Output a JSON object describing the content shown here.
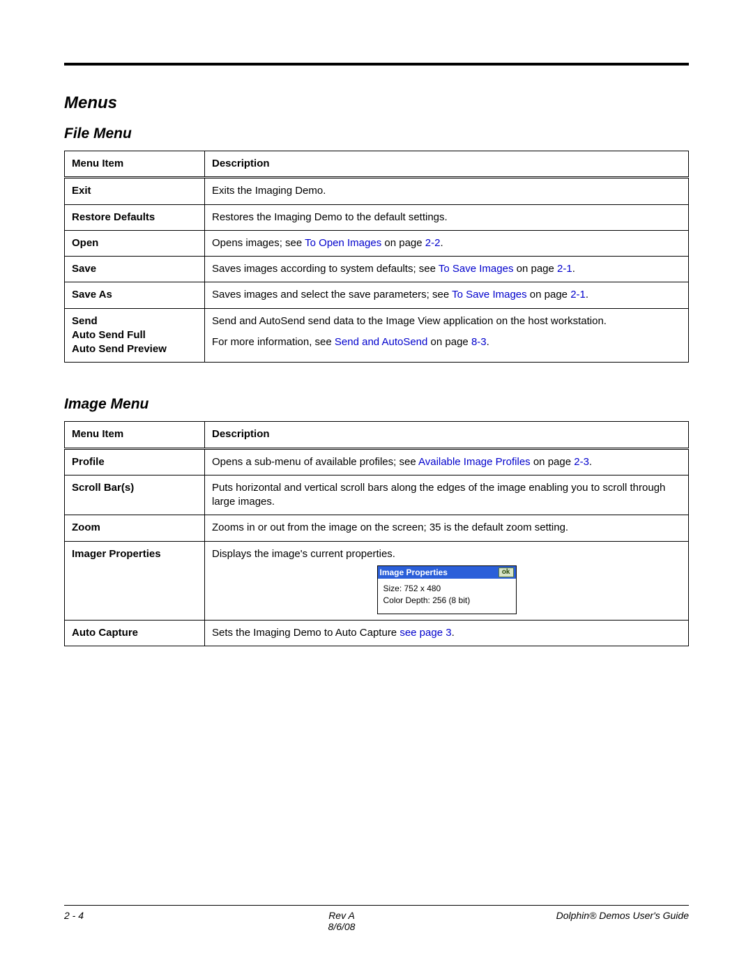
{
  "section_title": "Menus",
  "file_menu": {
    "title": "File Menu",
    "headers": {
      "item": "Menu Item",
      "desc": "Description"
    },
    "rows": {
      "exit": {
        "item": "Exit",
        "desc": "Exits the Imaging Demo."
      },
      "restore": {
        "item": "Restore Defaults",
        "desc": "Restores the Imaging Demo to the default settings."
      },
      "open": {
        "item": "Open",
        "pre": "Opens images; see ",
        "link": "To Open Images",
        "post": " on page ",
        "page": "2-2",
        "tail": "."
      },
      "save": {
        "item": "Save",
        "pre": "Saves images according to system defaults; see ",
        "link": "To Save Images",
        "post": " on page ",
        "page": "2-1",
        "tail": "."
      },
      "saveas": {
        "item": "Save As",
        "pre": "Saves images and select the save parameters; see ",
        "link": "To Save Images",
        "post": " on page ",
        "page": "2-1",
        "tail": "."
      },
      "send": {
        "item1": "Send",
        "item2": "Auto Send Full",
        "item3": "Auto Send Preview",
        "line1": "Send and AutoSend send data to the Image View application on the host workstation.",
        "pre": "For more information, see ",
        "link": "Send and AutoSend",
        "post": " on page ",
        "page": "8-3",
        "tail": "."
      }
    }
  },
  "image_menu": {
    "title": "Image Menu",
    "headers": {
      "item": "Menu Item",
      "desc": "Description"
    },
    "rows": {
      "profile": {
        "item": "Profile",
        "pre": "Opens a sub-menu of available profiles; see ",
        "link": "Available Image Profiles",
        "post": " on page ",
        "page": "2-3",
        "tail": "."
      },
      "scroll": {
        "item": "Scroll Bar(s)",
        "desc": "Puts horizontal and vertical scroll bars along the edges of the image enabling you to scroll through large images."
      },
      "zoom": {
        "item": "Zoom",
        "desc": "Zooms in or out from the image on the screen; 35 is the default zoom setting."
      },
      "imager": {
        "item": "Imager Properties",
        "desc": "Displays the image's current properties.",
        "dlg_title": "Image Properties",
        "dlg_ok": "ok",
        "dlg_size": "Size: 752 x 480",
        "dlg_depth": "Color Depth: 256 (8 bit)"
      },
      "auto": {
        "item": "Auto Capture",
        "pre": "Sets the Imaging Demo to Auto Capture ",
        "link": "see page ",
        "page": "3",
        "tail": "."
      }
    }
  },
  "footer": {
    "page": "2 - 4",
    "rev": "Rev A",
    "date": "8/6/08",
    "guide": "Dolphin® Demos User's Guide"
  }
}
